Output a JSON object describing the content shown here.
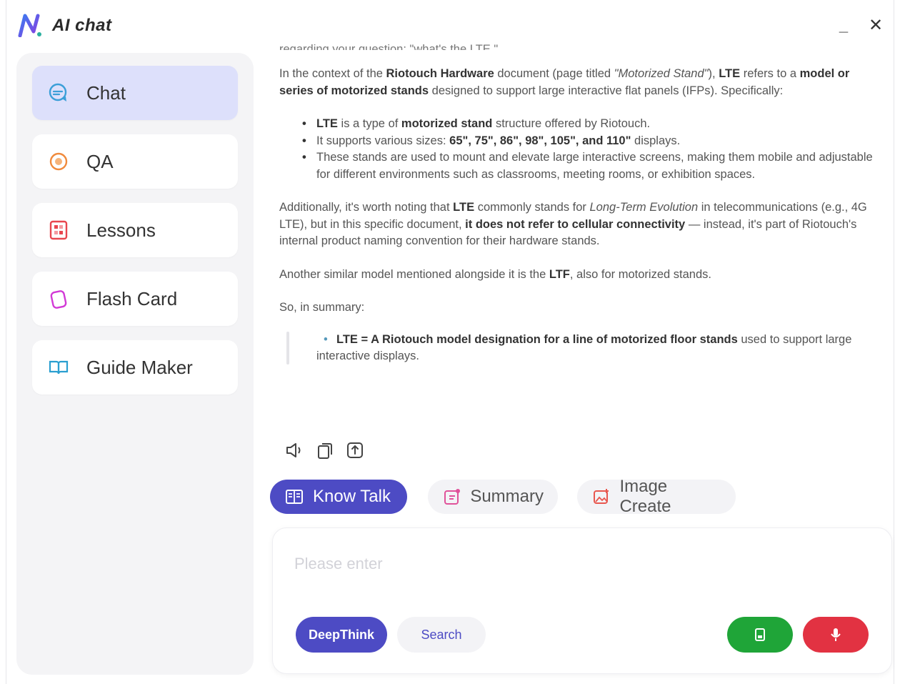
{
  "window": {
    "title": "AI chat",
    "minimize_label": "_",
    "close_label": "✕"
  },
  "sidebar": {
    "items": [
      {
        "label": "Chat",
        "icon": "chat-bubble-icon",
        "active": true
      },
      {
        "label": "QA",
        "icon": "qa-bubble-icon",
        "active": false
      },
      {
        "label": "Lessons",
        "icon": "lessons-grid-icon",
        "active": false
      },
      {
        "label": "Flash Card",
        "icon": "flash-card-icon",
        "active": false
      },
      {
        "label": "Guide Maker",
        "icon": "open-book-icon",
        "active": false
      }
    ]
  },
  "message": {
    "cut_line": "regarding your question: \"what's the LTE.\"",
    "p1_a": "In the context of the ",
    "p1_b": "Riotouch Hardware",
    "p1_c": " document (page titled ",
    "p1_d": "\"Motorized Stand\"",
    "p1_e": "), ",
    "p1_f": "LTE",
    "p1_g": " refers to a ",
    "p1_h": "model or series of motorized stands",
    "p1_i": " designed to support large interactive flat panels (IFPs). Specifically:",
    "b1_a": "LTE",
    "b1_b": " is a type of ",
    "b1_c": "motorized stand",
    "b1_d": " structure offered by Riotouch.",
    "b2_a": "It supports various sizes: ",
    "b2_b": "65\", 75\", 86\", 98\", 105\", and 110\"",
    "b2_c": " displays.",
    "b3": "These stands are used to mount and elevate large interactive screens, making them mobile and adjustable for different environments such as classrooms, meeting rooms, or exhibition spaces.",
    "p2_a": "Additionally, it's worth noting that ",
    "p2_b": "LTE",
    "p2_c": " commonly stands for ",
    "p2_d": "Long-Term Evolution",
    "p2_e": " in telecommunications (e.g., 4G LTE), but in this specific document, ",
    "p2_f": "it does not refer to cellular connectivity",
    "p2_g": " — instead, it's part of Riotouch's internal product naming convention for their hardware stands.",
    "p3_a": "Another similar model mentioned alongside it is the ",
    "p3_b": "LTF",
    "p3_c": ", also for motorized stands.",
    "p4": "So, in summary:",
    "q_a": "LTE = A Riotouch model designation for a line of motorized floor stands",
    "q_b": " used to support large interactive displays."
  },
  "actions": {
    "icons": [
      "speaker-icon",
      "copy-icon",
      "share-icon"
    ]
  },
  "tabs": [
    {
      "label": "Know Talk",
      "icon": "book-icon",
      "active": true
    },
    {
      "label": "Summary",
      "icon": "summary-doc-icon",
      "active": false
    },
    {
      "label": "Image Create",
      "icon": "image-create-icon",
      "active": false
    }
  ],
  "input": {
    "placeholder": "Please enter",
    "deepthink_label": "DeepThink",
    "search_label": "Search"
  },
  "colors": {
    "accent": "#4d4bc4",
    "active_nav": "#dde0fb",
    "green": "#1fa538",
    "red": "#e23242"
  }
}
